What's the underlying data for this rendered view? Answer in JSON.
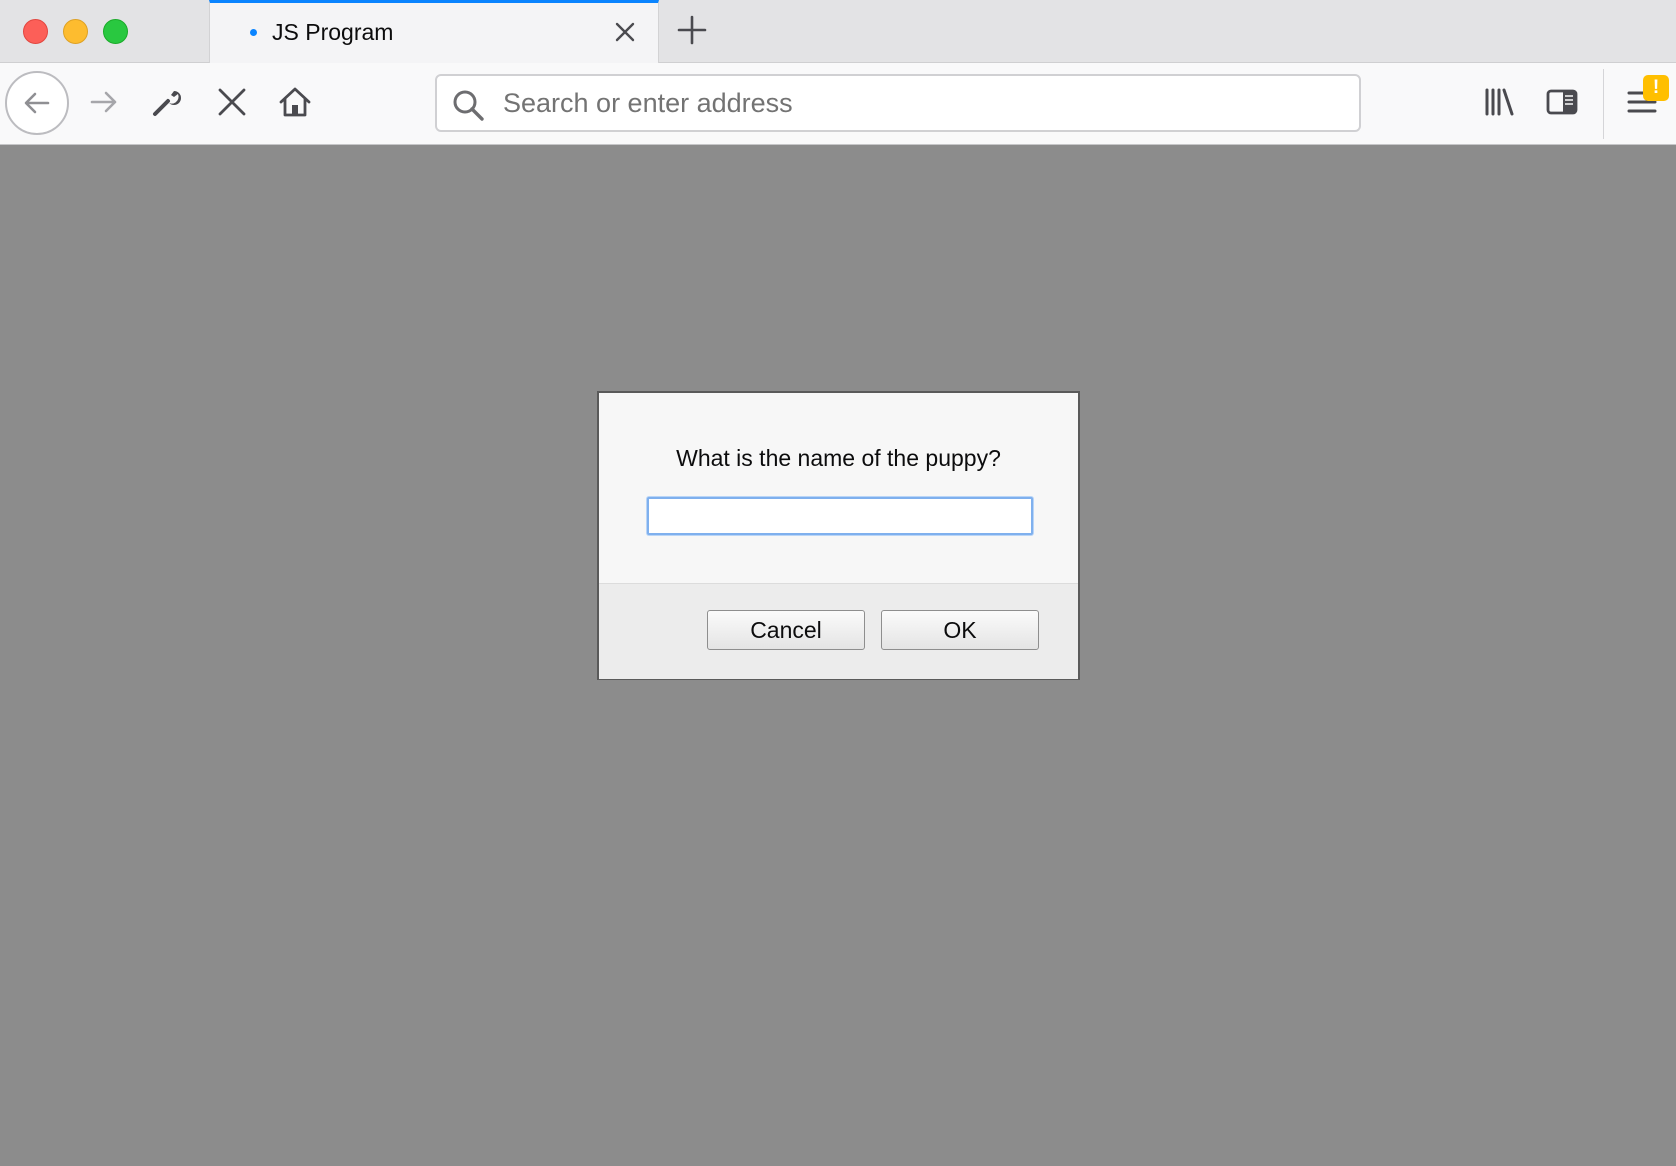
{
  "browser": {
    "tab": {
      "title": "JS Program"
    },
    "urlbar": {
      "placeholder": "Search or enter address"
    },
    "menu_badge": "!",
    "accent_color": "#0a84ff",
    "badge_color": "#ffbf00"
  },
  "toolbar_icons": [
    "back-icon",
    "forward-icon",
    "wrench-icon",
    "stop-icon",
    "home-icon",
    "library-icon",
    "sidebar-icon",
    "hamburger-menu-icon"
  ],
  "dialog": {
    "message": "What is the name of the puppy?",
    "input_value": "",
    "cancel_label": "Cancel",
    "ok_label": "OK"
  },
  "page": {
    "background_color": "#8c8c8c"
  }
}
